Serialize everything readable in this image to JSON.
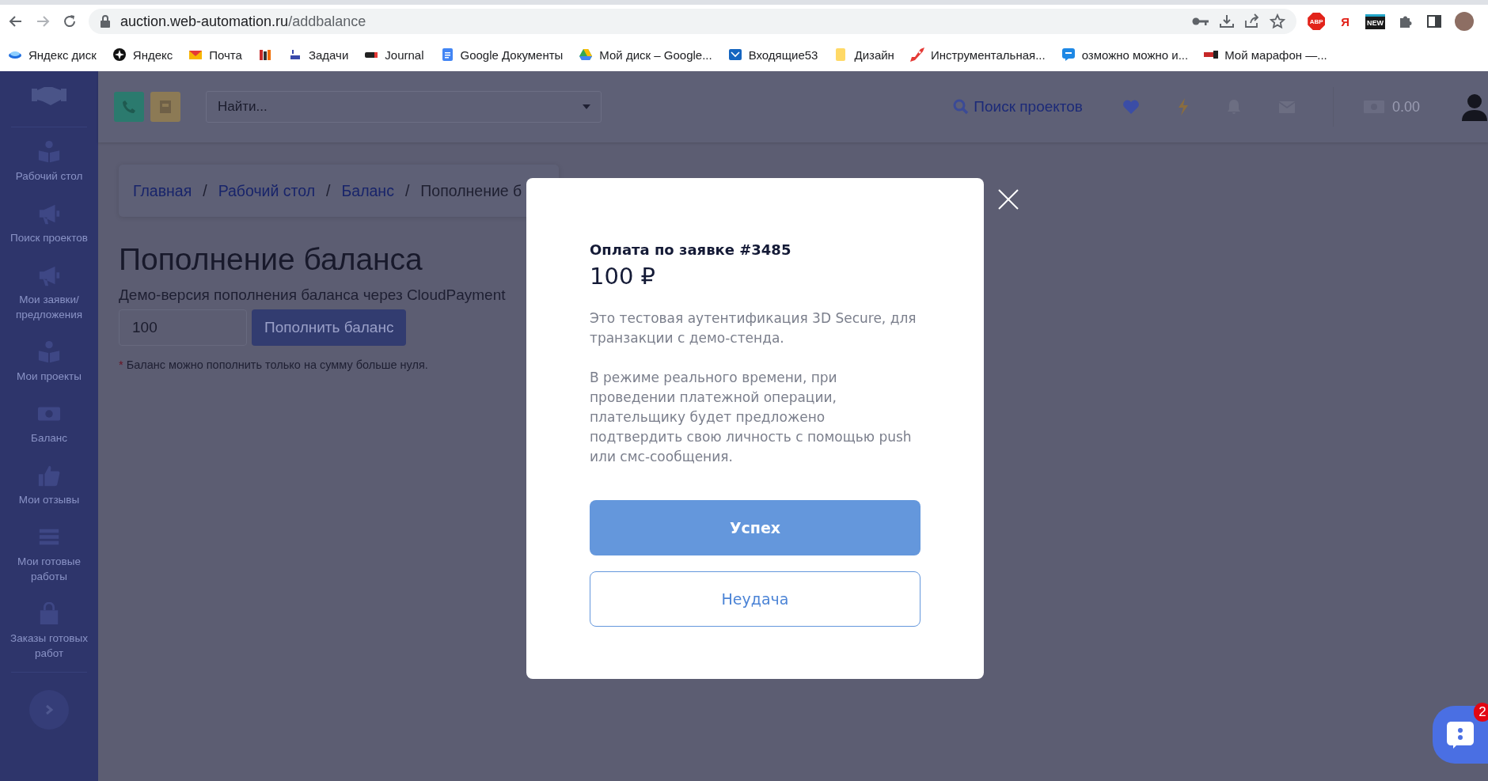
{
  "browser": {
    "url_host": "auction.web-automation.ru",
    "url_path": "/addbalance",
    "extensions": [
      {
        "kind": "abp",
        "label": "ABP"
      },
      {
        "kind": "yandex",
        "label": "Я"
      },
      {
        "kind": "new",
        "label": "NEW"
      },
      {
        "kind": "puzzle"
      },
      {
        "kind": "panel"
      }
    ],
    "bookmarks": [
      {
        "kind": "disk",
        "label": "Яндекс диск"
      },
      {
        "kind": "star",
        "label": "Яндекс"
      },
      {
        "kind": "mail",
        "label": "Почта"
      },
      {
        "kind": "books"
      },
      {
        "kind": "tasks",
        "label": "Задачи"
      },
      {
        "kind": "journal",
        "label": "Journal"
      },
      {
        "kind": "doc",
        "label": "Google Документы"
      },
      {
        "kind": "drive",
        "label": "Мой диск – Google..."
      },
      {
        "kind": "inbox",
        "label": "Входящие53"
      },
      {
        "kind": "folder",
        "label": "Дизайн"
      },
      {
        "kind": "rocket",
        "label": "Инструментальная..."
      },
      {
        "kind": "chat",
        "label": "озможно можно и..."
      },
      {
        "kind": "dots",
        "label": "Мой марафон —..."
      }
    ]
  },
  "sidebar": {
    "items": [
      {
        "kind": "reader",
        "label": "Рабочий стол"
      },
      {
        "kind": "megaphone",
        "label": "Поиск проектов"
      },
      {
        "kind": "megaphone",
        "label": "Мои заявки/ предложения"
      },
      {
        "kind": "reader",
        "label": "Мои проекты"
      },
      {
        "kind": "money",
        "label": "Баланс"
      },
      {
        "kind": "thumb",
        "label": "Мои отзывы"
      },
      {
        "kind": "bars",
        "label": "Мои готовые работы"
      },
      {
        "kind": "bag",
        "label": "Заказы готовых работ"
      }
    ]
  },
  "header": {
    "search_placeholder": "Найти...",
    "project_search": "Поиск проектов",
    "balance": "0.00"
  },
  "breadcrumbs": [
    {
      "label": "Главная",
      "link": true,
      "separator": "/"
    },
    {
      "label": "Рабочий стол",
      "link": true,
      "separator": "/"
    },
    {
      "label": "Баланс",
      "link": true,
      "separator": "/"
    },
    {
      "label": "Пополнение б",
      "link": false
    }
  ],
  "page": {
    "title": "Пополнение баланса",
    "subtitle": "Демо-версия пополнения баланса через CloudPayment",
    "amount": "100",
    "submit": "Пополнить баланс",
    "note_mark": "*",
    "note": "Баланс можно пополнить только на сумму больше нуля."
  },
  "modal": {
    "title": "Оплата по заявке #3485",
    "amount": "100 ₽",
    "paragraphs": [
      "Это тестовая аутентификация 3D Secure, для транзакции с демо-стенда.",
      "В режиме реального времени, при проведении платежной операции, плательщику будет предложено подтвердить свою личность с помощью push или смс-сообщения."
    ],
    "buttons": [
      {
        "kind": "primary",
        "label": "Успех"
      },
      {
        "kind": "secondary",
        "label": "Неудача"
      }
    ]
  },
  "chat": {
    "badge": "2"
  }
}
